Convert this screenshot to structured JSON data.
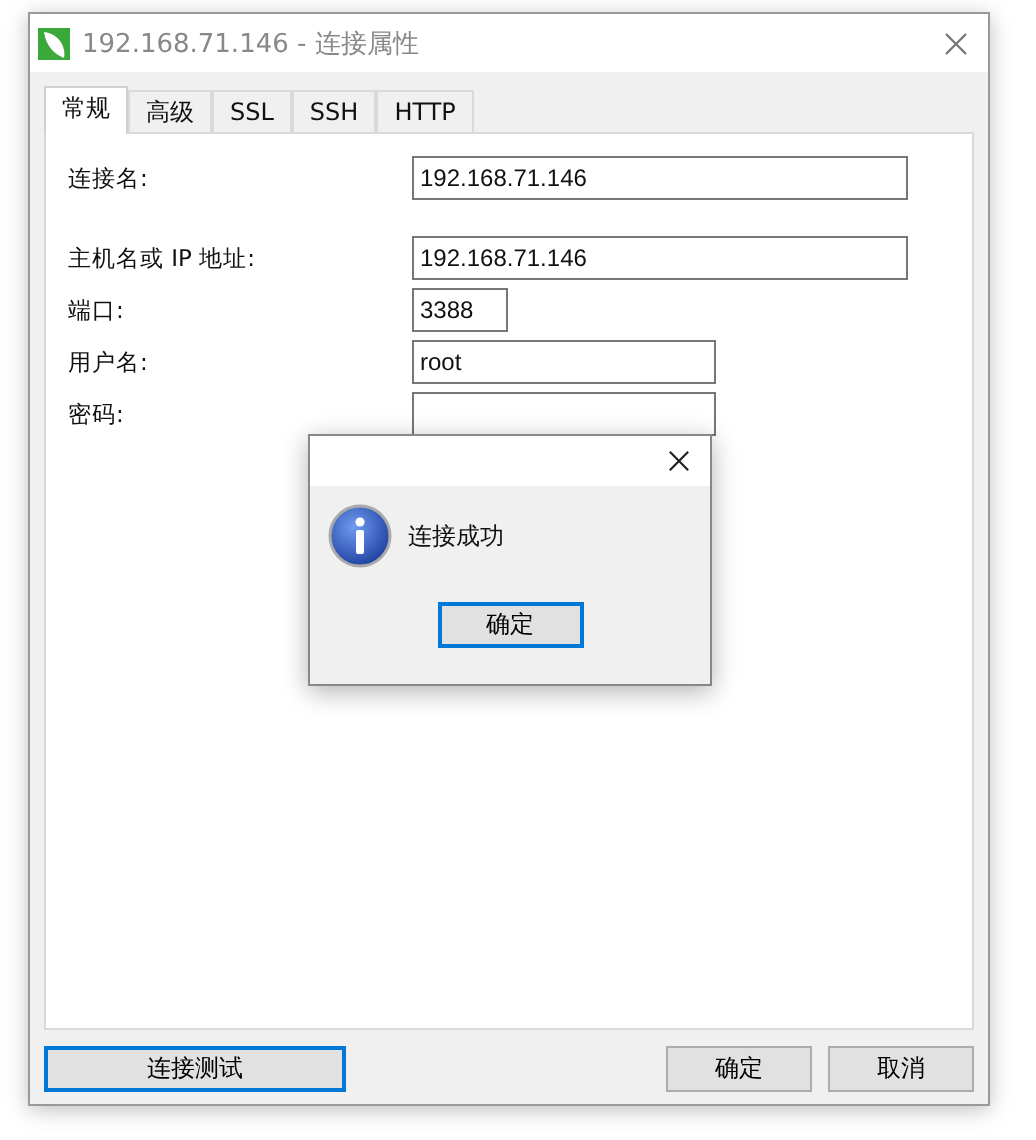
{
  "window": {
    "title": "192.168.71.146 - 连接属性"
  },
  "tabs": [
    {
      "label": "常规",
      "selected": true
    },
    {
      "label": "高级",
      "selected": false
    },
    {
      "label": "SSL",
      "selected": false
    },
    {
      "label": "SSH",
      "selected": false
    },
    {
      "label": "HTTP",
      "selected": false
    }
  ],
  "field_groups": [
    {
      "fields": [
        {
          "label": "连接名:",
          "value": "192.168.71.146"
        }
      ]
    },
    {
      "fields": [
        {
          "label": "主机名或 IP 地址:",
          "value": "192.168.71.146"
        },
        {
          "label": "端口:",
          "value": "3388"
        },
        {
          "label": "用户名:",
          "value": "root"
        },
        {
          "label": "密码:"
        }
      ]
    }
  ],
  "buttons": {
    "test": "连接测试",
    "ok": "确定",
    "cancel": "取消"
  },
  "message_box": {
    "message": "连接成功",
    "button": "确定"
  }
}
